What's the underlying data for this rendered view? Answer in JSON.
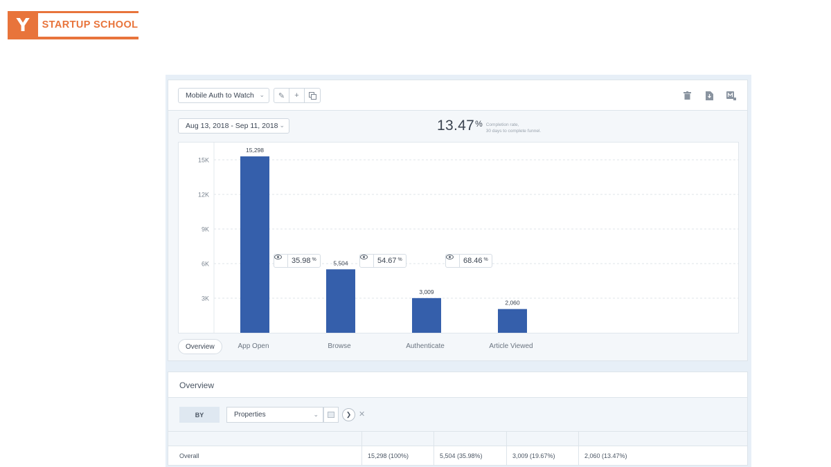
{
  "logo": {
    "letter": "Y",
    "text": "STARTUP SCHOOL",
    "color": "#e8743b"
  },
  "toolbar": {
    "funnel_select": "Mobile Auth to Watch",
    "edit_icon": "pencil-icon",
    "add_icon": "plus-icon",
    "duplicate_icon": "duplicate-icon",
    "right_icons": [
      "trash-icon",
      "download-icon",
      "export-icon"
    ]
  },
  "date_range": "Aug 13, 2018 - Sep 11, 2018",
  "completion": {
    "value": "13.47",
    "unit": "%",
    "line1": "Completion rate,",
    "line2": "30 days to complete funnel."
  },
  "chart_data": {
    "type": "bar",
    "categories": [
      "App Open",
      "Browse",
      "Authenticate",
      "Article Viewed"
    ],
    "values": [
      15298,
      5504,
      3009,
      2060
    ],
    "value_labels": [
      "15,298",
      "5,504",
      "3,009",
      "2,060"
    ],
    "conversion": [
      {
        "value": "35.98",
        "unit": "%"
      },
      {
        "value": "54.67",
        "unit": "%"
      },
      {
        "value": "68.46",
        "unit": "%"
      }
    ],
    "yticks": [
      3000,
      6000,
      9000,
      12000,
      15000
    ],
    "ytick_labels": [
      "3K",
      "6K",
      "9K",
      "12K",
      "15K"
    ],
    "ylim": [
      0,
      16500
    ],
    "bar_color": "#355fab",
    "grid": true
  },
  "tabs": {
    "overview": "Overview",
    "steps": [
      "App Open",
      "Browse",
      "Authenticate",
      "Article Viewed"
    ]
  },
  "overview": {
    "title": "Overview",
    "by_label": "BY",
    "properties_select": "Properties",
    "table": {
      "row_label": "Overall",
      "cells": [
        "15,298 (100%)",
        "5,504 (35.98%)",
        "3,009 (19.67%)",
        "2,060 (13.47%)"
      ]
    }
  }
}
